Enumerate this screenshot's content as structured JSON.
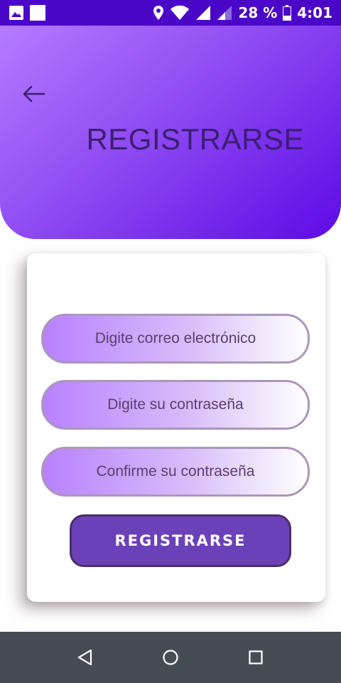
{
  "status_bar": {
    "battery_percent": "28 %",
    "time": "4:01",
    "icons": [
      "image-icon",
      "notification-square-icon",
      "location-icon",
      "wifi-icon",
      "signal-icon",
      "signal-weak-icon",
      "battery-icon"
    ]
  },
  "header": {
    "back_icon": "arrow-left-icon",
    "title": "REGISTRARSE"
  },
  "form": {
    "email_placeholder": "Digite correo electrónico",
    "password_placeholder": "Digite su contraseña",
    "confirm_placeholder": "Confirme su contraseña",
    "submit_label": "REGISTRARSE"
  },
  "nav_bar": {
    "buttons": [
      "back-triangle-icon",
      "home-circle-icon",
      "recents-square-icon"
    ]
  },
  "colors": {
    "status_bar": "#4b07c8",
    "header_gradient_start": "#b57bff",
    "header_gradient_end": "#5e0ae6",
    "title_text": "#3b1f73",
    "field_border": "#aa97bb",
    "field_text": "#5b3f6e",
    "button_bg": "#6b41b9",
    "nav_bar": "#464c53"
  }
}
